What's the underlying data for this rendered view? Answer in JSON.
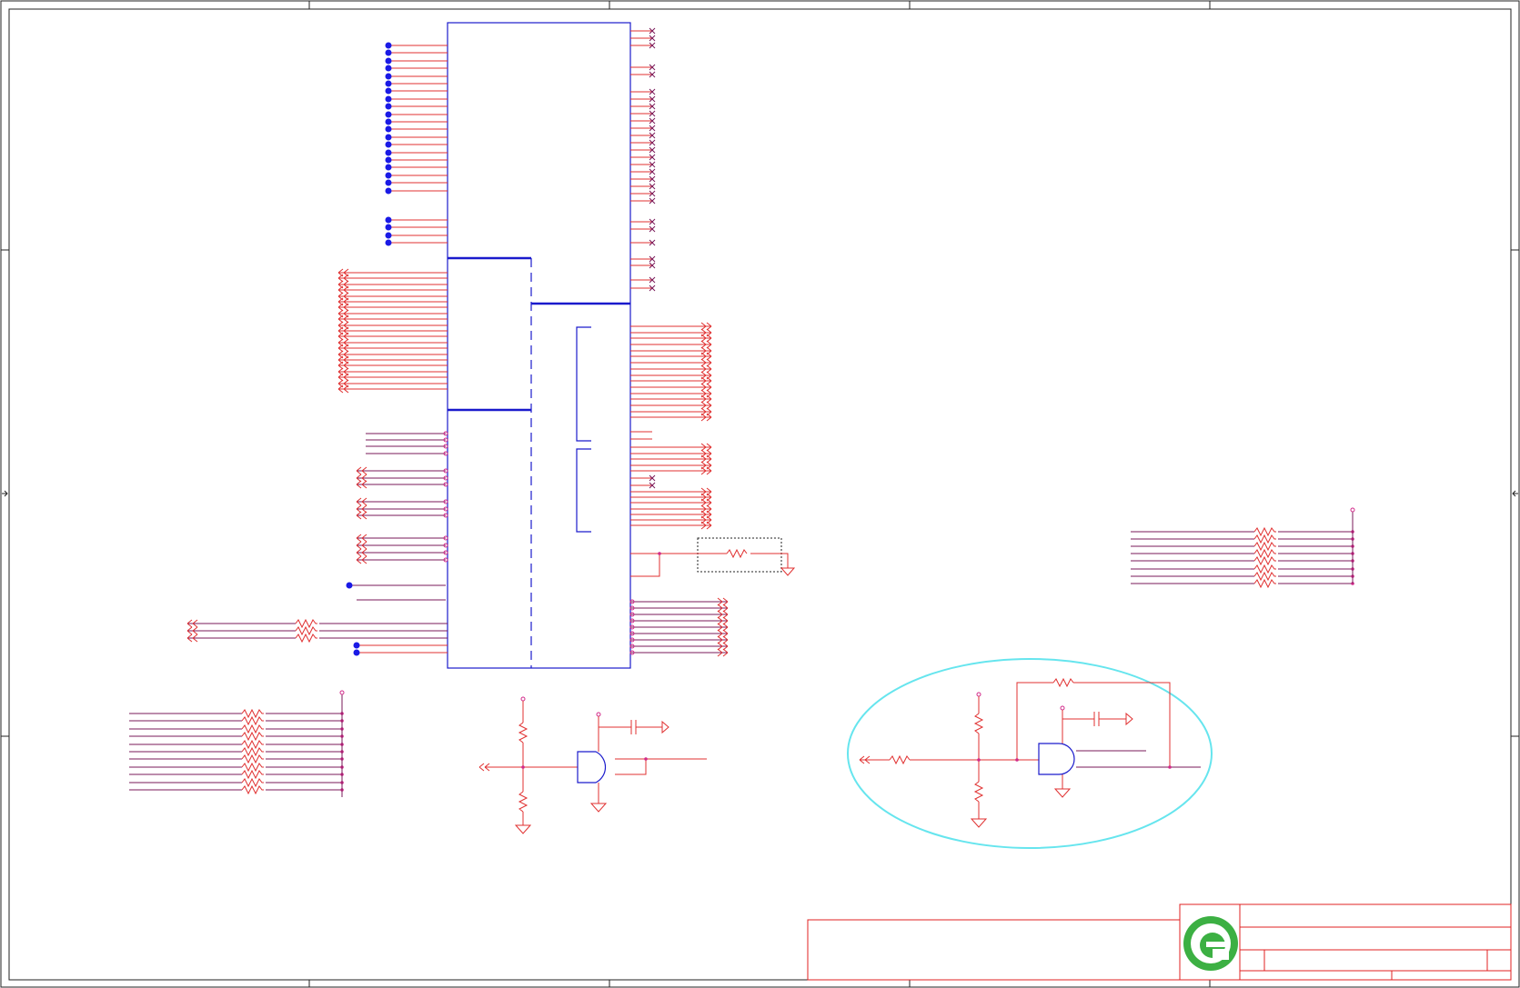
{
  "sheet": {
    "colors": {
      "border": "#222222",
      "symbol": "#1a1acc",
      "wire": "#e03030",
      "net": "#7a1a5a",
      "pin": "#d12a8a",
      "junction": "#1a1ae6",
      "highlight": "#66e5ee",
      "title_block_frame": "#e02020",
      "logo": "#3cb043"
    },
    "icons": [
      "resistor-icon",
      "capacitor-icon",
      "ground-icon",
      "and-gate-icon",
      "power-port-icon",
      "off-sheet-connector-icon",
      "no-connect-icon",
      "junction-dot-icon",
      "company-logo-icon"
    ]
  }
}
